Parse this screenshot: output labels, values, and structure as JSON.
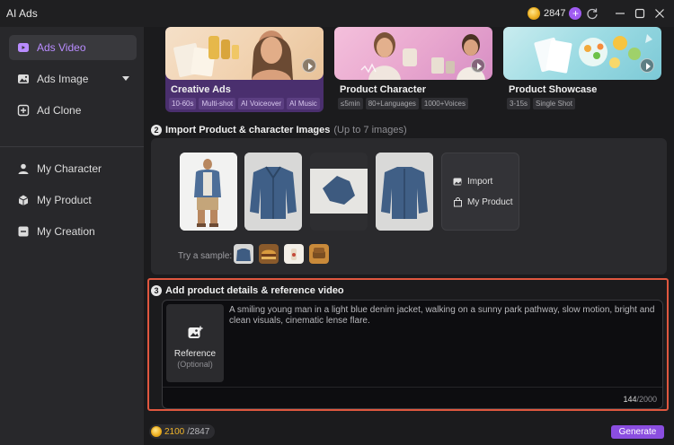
{
  "app": {
    "title": "AI Ads"
  },
  "credits": {
    "balance": "2847"
  },
  "sidebar": {
    "items": [
      {
        "label": "Ads Video",
        "icon": "video-icon",
        "active": true
      },
      {
        "label": "Ads Image",
        "icon": "image-icon",
        "has_dropdown": true
      },
      {
        "label": "Ad Clone",
        "icon": "clone-icon"
      },
      {
        "label": "My Character",
        "icon": "person-icon"
      },
      {
        "label": "My Product",
        "icon": "box-icon"
      },
      {
        "label": "My Creation",
        "icon": "folder-icon"
      }
    ]
  },
  "templates": [
    {
      "title": "Creative Ads",
      "tags": [
        "10-60s",
        "Multi-shot",
        "AI Voiceover",
        "AI Music"
      ],
      "selected": true
    },
    {
      "title": "Product Character",
      "tags": [
        "≤5min",
        "80+Languages",
        "1000+Voices"
      ],
      "selected": false
    },
    {
      "title": "Product Showcase",
      "tags": [
        "3-15s",
        "Single Shot"
      ],
      "selected": false
    }
  ],
  "import_section": {
    "step": "2",
    "heading": "Import Product & character Images",
    "note": "(Up to 7 images)",
    "import_label": "Import",
    "my_product_label": "My Product",
    "try_sample_label": "Try a sample:"
  },
  "details_section": {
    "step": "3",
    "heading": "Add product details & reference video",
    "reference_label": "Reference",
    "reference_sub": "(Optional)",
    "prompt": "A smiling young man in a light blue denim jacket, walking on a sunny park pathway, slow motion, bright and clean visuals, cinematic lense flare.",
    "char_count": "144",
    "char_max": "/2000"
  },
  "footer": {
    "cost_used": "2100",
    "cost_total": "/2847",
    "generate_label": "Generate"
  },
  "colors": {
    "accent": "#8b4ee0",
    "highlight_border": "#e0573f",
    "coin": "#f0b429"
  }
}
